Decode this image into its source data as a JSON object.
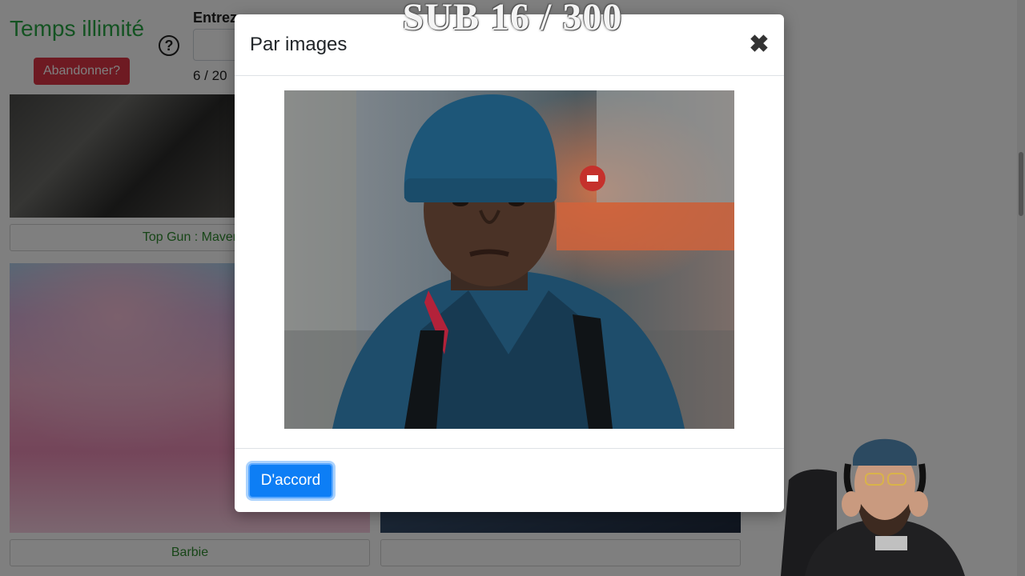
{
  "game": {
    "title": "Temps illimité",
    "help_icon": "?",
    "give_up_label": "Abandonner?",
    "entry_label": "Entrez",
    "counter_text": "6 / 20"
  },
  "cards": [
    {
      "label": "Top Gun : Maver"
    },
    {
      "label": ""
    },
    {
      "label": "Barbie"
    },
    {
      "label": ""
    }
  ],
  "modal": {
    "title": "Par images",
    "close_icon": "✖",
    "image_subject": "clue-film-still",
    "ok_label": "D'accord",
    "ok_color": "#0d7ef5"
  },
  "stream_overlay": {
    "counter_text": "SUB 16 / 300"
  },
  "colors": {
    "title_green": "#28a745",
    "danger_red": "#dc3545",
    "label_green": "#2e8b2e"
  }
}
